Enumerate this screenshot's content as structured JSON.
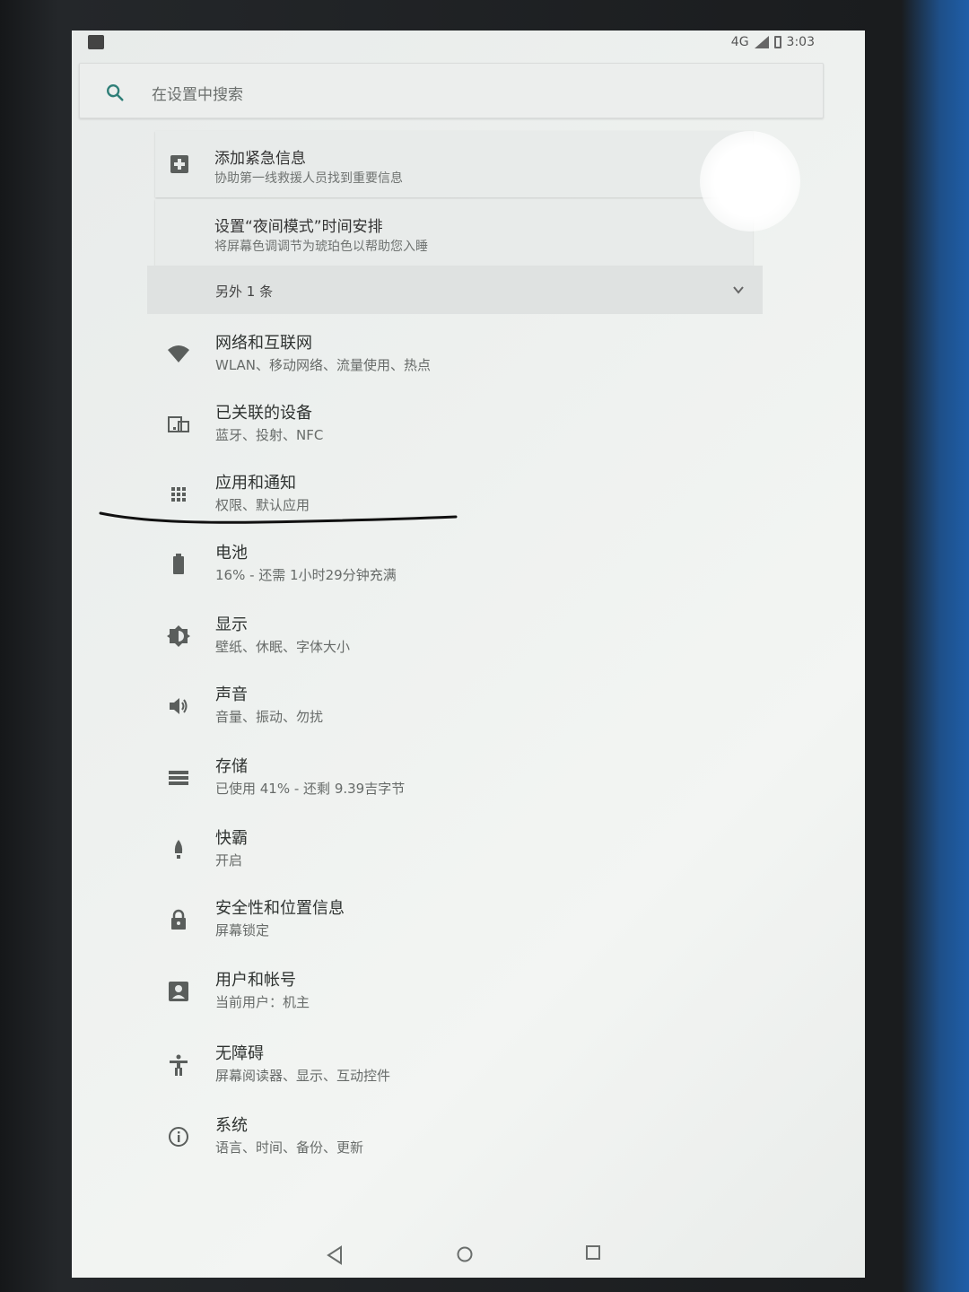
{
  "status_bar": {
    "network": "4G",
    "time": "3:03"
  },
  "search": {
    "placeholder": "在设置中搜索"
  },
  "suggestions": [
    {
      "title": "添加紧急信息",
      "subtitle": "协助第一线救援人员找到重要信息",
      "icon": "medical-plus-icon"
    },
    {
      "title": "设置“夜间模式”时间安排",
      "subtitle": "将屏幕色调调节为琥珀色以帮助您入睡",
      "icon": "moon-icon"
    }
  ],
  "more": {
    "label": "另外 1 条"
  },
  "settings": [
    {
      "title": "网络和互联网",
      "subtitle": "WLAN、移动网络、流量使用、热点",
      "icon": "wifi-icon"
    },
    {
      "title": "已关联的设备",
      "subtitle": "蓝牙、投射、NFC",
      "icon": "devices-icon"
    },
    {
      "title": "应用和通知",
      "subtitle": "权限、默认应用",
      "icon": "apps-grid-icon"
    },
    {
      "title": "电池",
      "subtitle": "16% - 还需 1小时29分钟充满",
      "icon": "battery-icon"
    },
    {
      "title": "显示",
      "subtitle": "壁纸、休眠、字体大小",
      "icon": "brightness-icon"
    },
    {
      "title": "声音",
      "subtitle": "音量、振动、勿扰",
      "icon": "volume-icon"
    },
    {
      "title": "存储",
      "subtitle": "已使用 41% - 还剩 9.39吉字节",
      "icon": "storage-icon"
    },
    {
      "title": "快霸",
      "subtitle": "开启",
      "icon": "rocket-icon"
    },
    {
      "title": "安全性和位置信息",
      "subtitle": "屏幕锁定",
      "icon": "lock-icon"
    },
    {
      "title": "用户和帐号",
      "subtitle": "当前用户：机主",
      "icon": "account-icon"
    },
    {
      "title": "无障碍",
      "subtitle": "屏幕阅读器、显示、互动控件",
      "icon": "accessibility-icon"
    },
    {
      "title": "系统",
      "subtitle": "语言、时间、备份、更新",
      "icon": "info-icon"
    }
  ],
  "colors": {
    "icon": "#5a5e5c",
    "search_accent": "#2f7f78",
    "text_primary": "#2f3331"
  }
}
